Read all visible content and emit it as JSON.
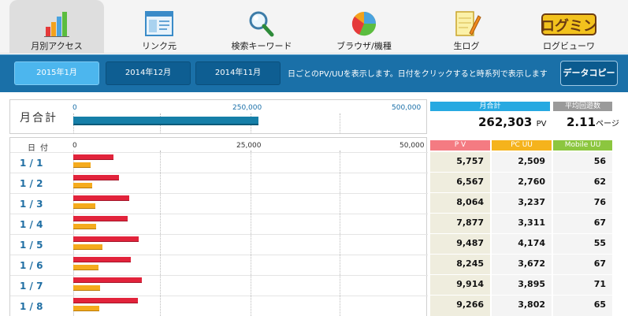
{
  "nav": {
    "items": [
      {
        "label": "月別アクセス",
        "icon": "bar-chart-icon"
      },
      {
        "label": "リンク元",
        "icon": "browser-window-icon"
      },
      {
        "label": "検索キーワード",
        "icon": "magnifier-icon"
      },
      {
        "label": "ブラウザ/機種",
        "icon": "pie-chart-icon"
      },
      {
        "label": "生ログ",
        "icon": "notepad-pencil-icon"
      },
      {
        "label": "ログビューワ",
        "icon": "logmin-logo-icon",
        "logo_text": "ログミン"
      }
    ],
    "active_index": 0
  },
  "months": {
    "buttons": [
      "2015年1月",
      "2014年12月",
      "2014年11月"
    ],
    "active_index": 0,
    "hint": "日ごとのPV/UUを表示します。日付をクリックすると時系列で表示します",
    "copy_label": "データコピー"
  },
  "monthly_total": {
    "title": "月合計",
    "axis_ticks": [
      "0",
      "250,000",
      "500,000"
    ],
    "axis_max": 500000,
    "pv_value": 262303,
    "total_header": "月合計",
    "total_value": "262,303",
    "total_unit": "PV",
    "avg_header": "平均回遊数",
    "avg_value": "2.11",
    "avg_unit": "ページ"
  },
  "daily": {
    "date_header": "日付",
    "axis_ticks": [
      "0",
      "25,000",
      "50,000"
    ],
    "axis_max": 50000,
    "columns": [
      "P V",
      "PC UU",
      "Mobile UU"
    ],
    "column_colors": [
      "#f47b82",
      "#f5b31c",
      "#8cc63f"
    ],
    "rows": [
      {
        "date": "1 / 1",
        "pv": "5,757",
        "pc_uu": "2,509",
        "mobile_uu": "56",
        "pv_n": 5757,
        "uu_n": 2509
      },
      {
        "date": "1 / 2",
        "pv": "6,567",
        "pc_uu": "2,760",
        "mobile_uu": "62",
        "pv_n": 6567,
        "uu_n": 2760
      },
      {
        "date": "1 / 3",
        "pv": "8,064",
        "pc_uu": "3,237",
        "mobile_uu": "76",
        "pv_n": 8064,
        "uu_n": 3237
      },
      {
        "date": "1 / 4",
        "pv": "7,877",
        "pc_uu": "3,311",
        "mobile_uu": "67",
        "pv_n": 7877,
        "uu_n": 3311
      },
      {
        "date": "1 / 5",
        "pv": "9,487",
        "pc_uu": "4,174",
        "mobile_uu": "55",
        "pv_n": 9487,
        "uu_n": 4174
      },
      {
        "date": "1 / 6",
        "pv": "8,245",
        "pc_uu": "3,672",
        "mobile_uu": "67",
        "pv_n": 8245,
        "uu_n": 3672
      },
      {
        "date": "1 / 7",
        "pv": "9,914",
        "pc_uu": "3,895",
        "mobile_uu": "71",
        "pv_n": 9914,
        "uu_n": 3895
      },
      {
        "date": "1 / 8",
        "pv": "9,266",
        "pc_uu": "3,802",
        "mobile_uu": "65",
        "pv_n": 9266,
        "uu_n": 3802
      }
    ]
  },
  "colors": {
    "nav_bg": "#f4f4f4",
    "month_bar": "#1a70a8",
    "active_month": "#4cb6ee",
    "pv_bar": "#e2233b",
    "uu_bar": "#f5ab1d",
    "total_bar": "#167fa8",
    "total_header": "#27a9e1",
    "avg_header": "#9a9a9a",
    "number_cell_bg": "#efedde"
  }
}
